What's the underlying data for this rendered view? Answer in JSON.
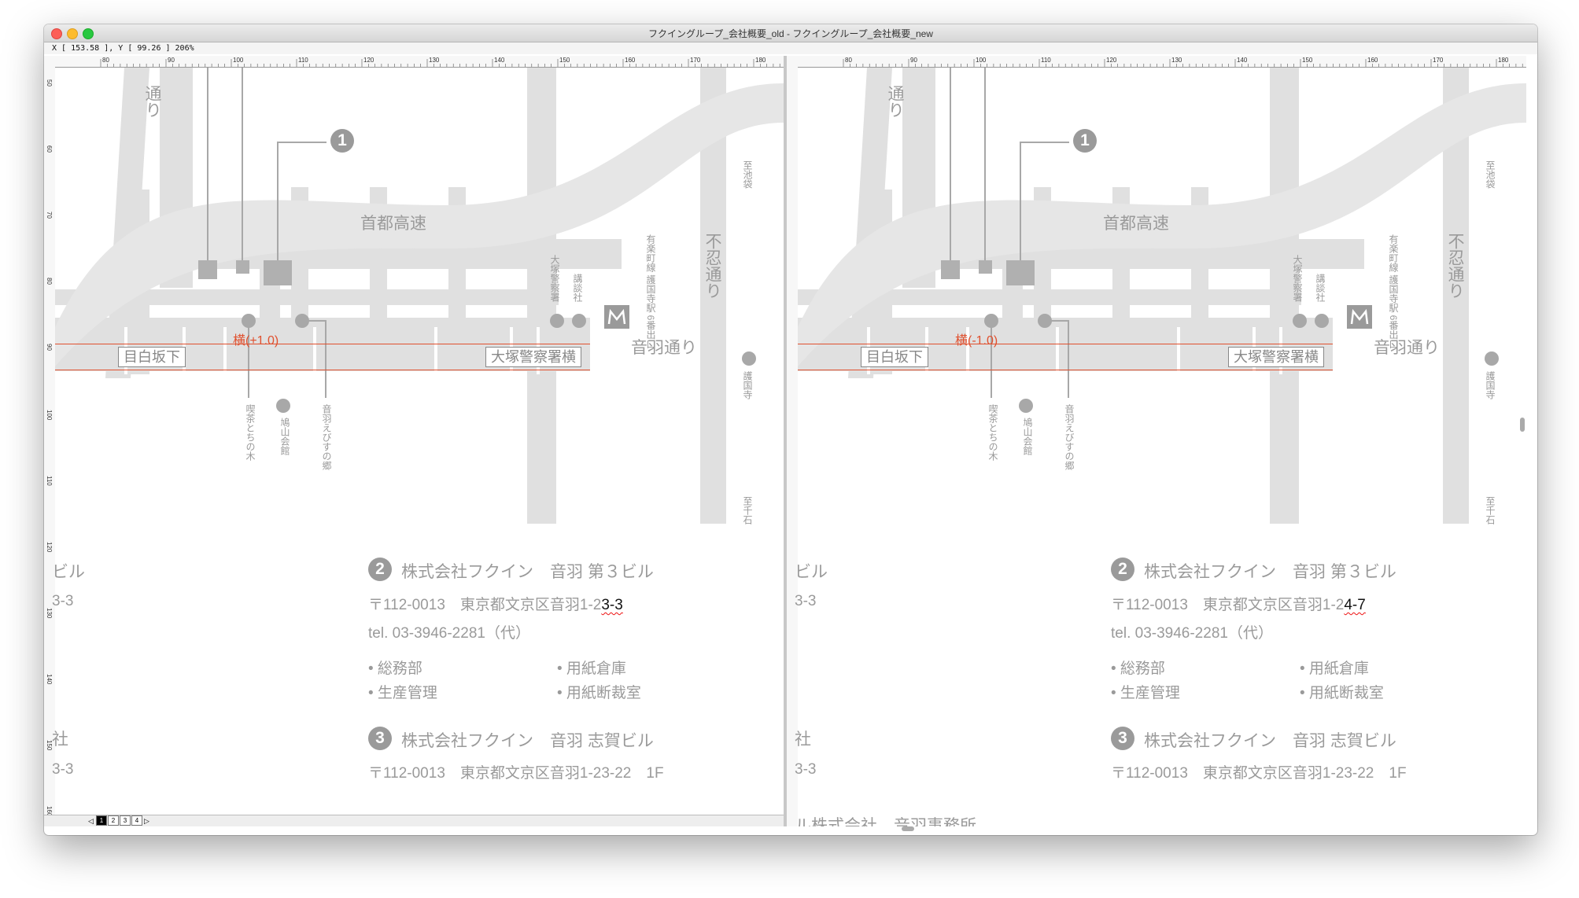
{
  "window": {
    "title": "フクイングループ_会社概要_old - フクイングループ_会社概要_new",
    "coords": "X [  153.58 ], Y [   99.26 ]   206%"
  },
  "rulers": {
    "h_left": [
      "80",
      "90",
      "100",
      "110",
      "120",
      "130",
      "140",
      "150",
      "160",
      "170",
      "180"
    ],
    "h_right": [
      "80",
      "90",
      "100",
      "110",
      "120",
      "130",
      "140",
      "150",
      "160",
      "170",
      "180"
    ],
    "v": [
      "50",
      "60",
      "70",
      "80",
      "90",
      "100",
      "110",
      "120",
      "130",
      "140",
      "150",
      "160"
    ]
  },
  "map": {
    "street_top": "通り",
    "highway": "首都高速",
    "right_street": "不忍通り",
    "otowa_dori": "音羽通り",
    "mejiro": "目白坂下",
    "otsuka_box": "大塚警察署横",
    "police": "大塚警察署",
    "kodansha": "講談社",
    "station": "有楽町線 護国寺駅 6番出口",
    "to_ikebukuro": "至池袋",
    "gokokuji": "護国寺",
    "to_sengoku": "至千石",
    "kissa": "喫茶とちの木",
    "hatoyama": "鳩山会館",
    "otowa_ebisu": "音羽えびすの郷",
    "marker1": "1"
  },
  "panes": {
    "left": {
      "offset_label": "横(+1.0)",
      "zip_prefix": "〒112-0013　東京都文京区音羽1-2",
      "zip_changed": "3-3"
    },
    "right": {
      "offset_label": "横(-1.0)",
      "zip_prefix": "〒112-0013　東京都文京区音羽1-2",
      "zip_changed": "4-7"
    }
  },
  "company": {
    "badge2": "2",
    "heading2": "株式会社フクイン　音羽 第３ビル",
    "tel": "tel. 03-3946-2281（代）",
    "dept1": "• 総務部",
    "dept2": "• 生産管理",
    "dept3": "• 用紙倉庫",
    "dept4": "• 用紙断裁室",
    "badge3": "3",
    "heading3": "株式会社フクイン　音羽 志賀ビル",
    "addr3": "〒112-0013　東京都文京区音羽1-23-22　1F",
    "cut_building": "ビル",
    "cut_addr_1": "3-3",
    "cut_company": "社",
    "cut_addr_2": "3-3",
    "cut_bottom": "ル株式会社　音羽事務所"
  },
  "pager": {
    "pages": [
      "1",
      "2",
      "3",
      "4"
    ]
  },
  "colors": {
    "road": "#e0e0e0",
    "text_gray": "#9a9a9a",
    "diff_red": "#e0502e"
  }
}
